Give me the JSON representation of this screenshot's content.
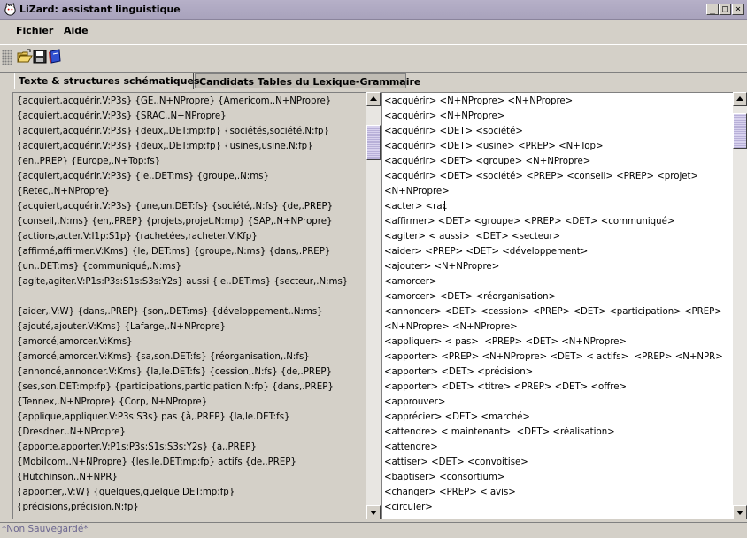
{
  "window": {
    "title": "LiZard: assistant linguistique",
    "icon": "cat-icon",
    "controls": {
      "minimize": "_",
      "maximize": "□",
      "close": "×"
    }
  },
  "menu": [
    "Fichier",
    "Aide"
  ],
  "toolbar": {
    "buttons": [
      "open-folder-icon",
      "save-icon",
      "book-icon"
    ]
  },
  "tabs": [
    {
      "label": "Texte & structures schématiques",
      "active": true
    },
    {
      "label": "Candidats Tables du Lexique-Grammaire",
      "active": false
    }
  ],
  "left_lines": [
    "{acquiert,acquérir.V:P3s} {GE,.N+NPropre} {Americom,.N+NPropre}",
    "{acquiert,acquérir.V:P3s} {SRAC,.N+NPropre}",
    "{acquiert,acquérir.V:P3s} {deux,.DET:mp:fp} {sociétés,société.N:fp}",
    "{acquiert,acquérir.V:P3s} {deux,.DET:mp:fp} {usines,usine.N:fp}",
    "{en,.PREP} {Europe,.N+Top:fs}",
    "{acquiert,acquérir.V:P3s} {le,.DET:ms} {groupe,.N:ms}",
    "{Retec,.N+NPropre}",
    "{acquiert,acquérir.V:P3s} {une,un.DET:fs} {société,.N:fs} {de,.PREP}",
    "{conseil,.N:ms} {en,.PREP} {projets,projet.N:mp} {SAP,.N+NPropre}",
    "{actions,acter.V:I1p:S1p} {rachetées,racheter.V:Kfp}",
    "{affirmé,affirmer.V:Kms} {le,.DET:ms} {groupe,.N:ms} {dans,.PREP}",
    "{un,.DET:ms} {communiqué,.N:ms}",
    "{agite,agiter.V:P1s:P3s:S1s:S3s:Y2s} aussi {le,.DET:ms} {secteur,.N:ms}",
    "",
    "{aider,.V:W} {dans,.PREP} {son,.DET:ms} {développement,.N:ms}",
    "{ajouté,ajouter.V:Kms} {Lafarge,.N+NPropre}",
    "{amorcé,amorcer.V:Kms}",
    "{amorcé,amorcer.V:Kms} {sa,son.DET:fs} {réorganisation,.N:fs}",
    "{annoncé,annoncer.V:Kms} {la,le.DET:fs} {cession,.N:fs} {de,.PREP}",
    "{ses,son.DET:mp:fp} {participations,participation.N:fp} {dans,.PREP}",
    "{Tennex,.N+NPropre} {Corp,.N+NPropre}",
    "{applique,appliquer.V:P3s:S3s} pas {à,.PREP} {la,le.DET:fs}",
    "{Dresdner,.N+NPropre}",
    "{apporte,apporter.V:P1s:P3s:S1s:S3s:Y2s} {à,.PREP}",
    "{Mobilcom,.N+NPropre} {les,le.DET:mp:fp} actifs {de,.PREP}",
    "{Hutchinson,.N+NPR}",
    "{apporter,.V:W} {quelques,quelque.DET:mp:fp}",
    "{précisions,précision.N:fp}"
  ],
  "right_lines": [
    "<acquérir> <N+NPropre> <N+NPropre>",
    "<acquérir> <N+NPropre>",
    "<acquérir> <DET> <société>",
    "<acquérir> <DET> <usine> <PREP> <N+Top>",
    "<acquérir> <DET> <groupe> <N+NPropre>",
    "<acquérir> <DET> <société> <PREP> <conseil> <PREP> <projet>",
    "<N+NPropre>",
    "<acter> <rac",
    "<affirmer> <DET> <groupe> <PREP> <DET> <communiqué>",
    "<agiter> < aussi>  <DET> <secteur>",
    "<aider> <PREP> <DET> <développement>",
    "<ajouter> <N+NPropre>",
    "<amorcer>",
    "<amorcer> <DET> <réorganisation>",
    "<annoncer> <DET> <cession> <PREP> <DET> <participation> <PREP>",
    "<N+NPropre> <N+NPropre>",
    "<appliquer> < pas>  <PREP> <DET> <N+NPropre>",
    "<apporter> <PREP> <N+NPropre> <DET> < actifs>  <PREP> <N+NPR>",
    "<apporter> <DET> <précision>",
    "<apporter> <DET> <titre> <PREP> <DET> <offre>",
    "<approuver>",
    "<apprécier> <DET> <marché>",
    "<attendre> < maintenant>  <DET> <réalisation>",
    "<attendre>",
    "<attiser> <DET> <convoitise>",
    "<baptiser> <consortium>",
    "<changer> <PREP> < avis>",
    "<circuler>"
  ],
  "scroll": {
    "left_position": 0.05,
    "right_position": 0.02
  },
  "status": "*Non Sauvegardé*",
  "colors": {
    "titlebar": "#b0aac4",
    "status_text": "#6b6690",
    "thumb": "#c8c2e0"
  }
}
